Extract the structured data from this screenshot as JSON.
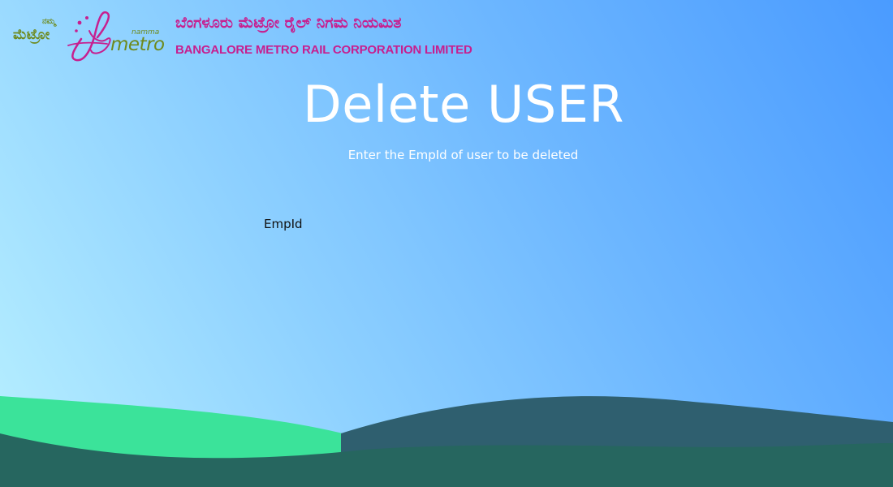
{
  "header": {
    "logo": {
      "kannada_small": "ನಮ್ಮ",
      "kannada_big": "ಮೆಟ್ರೋ",
      "namma": "namma",
      "metro": "metro",
      "brand_colors": {
        "magenta": "#c71f8f",
        "olive": "#6e8a1e"
      }
    },
    "org_name_kannada": "ಬೆಂಗಳೂರು ಮೆಟ್ರೋ ರೈಲ್ ನಿಗಮ ನಿಯಮಿತ",
    "org_name_english": "BANGALORE METRO RAIL CORPORATION LIMITED"
  },
  "page": {
    "title": "Delete USER",
    "subtitle": "Enter the EmpId of user to be deleted"
  },
  "form": {
    "empid_label": "EmpId",
    "empid_value": "",
    "empid_placeholder": ""
  },
  "theme": {
    "background_gradient": [
      "#b8f0ff",
      "#4a9bff"
    ],
    "wave_green": "#3be39a",
    "wave_dark": "#2f5f6f",
    "wave_teal": "#26665f"
  }
}
